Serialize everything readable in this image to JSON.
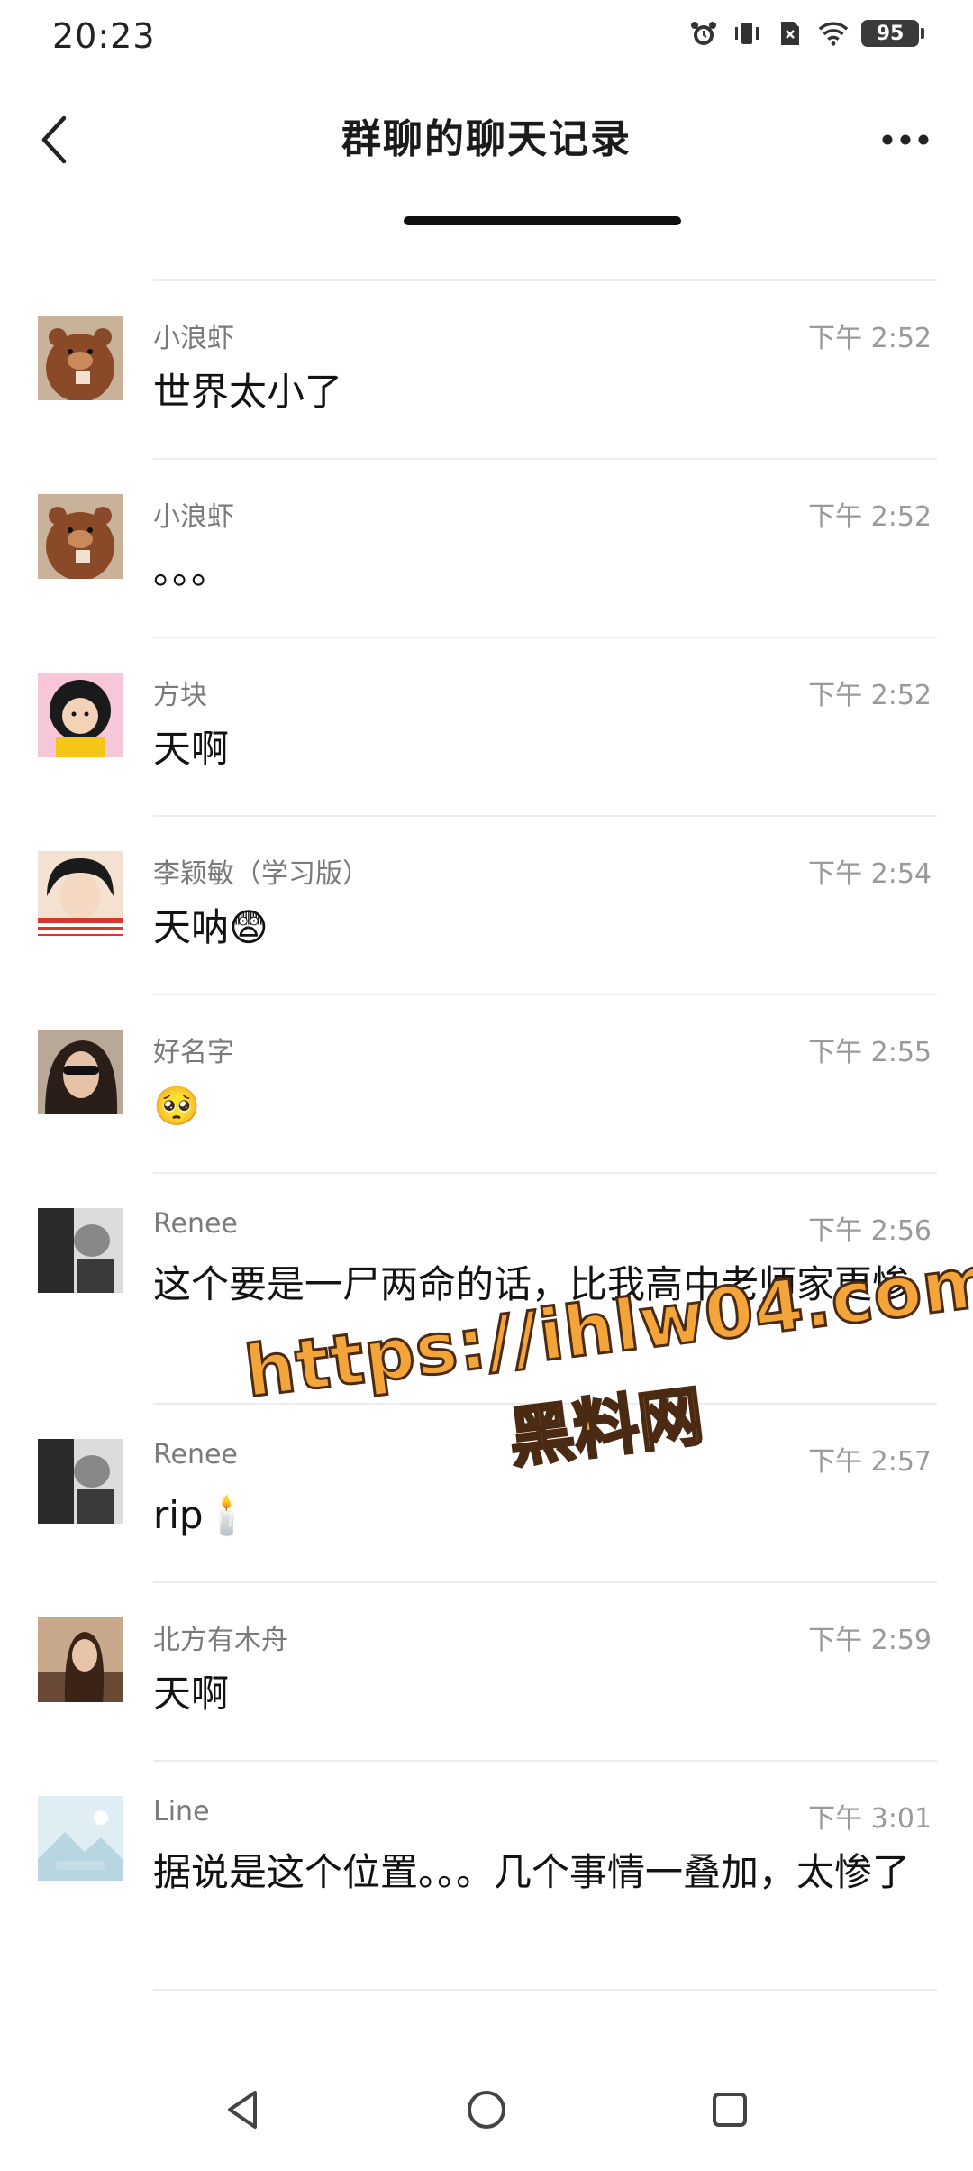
{
  "status": {
    "time": "20:23",
    "battery": "95"
  },
  "header": {
    "title": "群聊的聊天记录"
  },
  "messages": [
    {
      "sender": "小浪虾",
      "time": "下午 2:52",
      "text": "世界太小了",
      "avatar": "bear-avatar",
      "avatar_color": "#8a4a2a"
    },
    {
      "sender": "小浪虾",
      "time": "下午 2:52",
      "text": "。。。",
      "avatar": "bear-avatar",
      "avatar_color": "#8a4a2a"
    },
    {
      "sender": "方块",
      "time": "下午 2:52",
      "text": "天啊",
      "avatar": "cartoon-girl-avatar",
      "avatar_color": "#e85a8a"
    },
    {
      "sender": "李颖敏（学习版）",
      "time": "下午 2:54",
      "text": "天呐😨",
      "avatar": "illustrated-girl-avatar",
      "avatar_color": "#d9362f"
    },
    {
      "sender": "好名字",
      "time": "下午 2:55",
      "text": "🥺",
      "avatar": "sunglasses-woman-avatar",
      "avatar_color": "#3a2a22"
    },
    {
      "sender": "Renee",
      "time": "下午 2:56",
      "text": "这个要是一尸两命的话，比我高中老师家更惨",
      "avatar": "bw-photo-avatar",
      "avatar_color": "#666666"
    },
    {
      "sender": "Renee",
      "time": "下午 2:57",
      "text": "rip🕯️",
      "avatar": "bw-photo-avatar",
      "avatar_color": "#666666"
    },
    {
      "sender": "北方有木舟",
      "time": "下午 2:59",
      "text": "天啊",
      "avatar": "woman-outdoor-avatar",
      "avatar_color": "#7a5a4a"
    },
    {
      "sender": "Line",
      "time": "下午 3:01",
      "text": "据说是这个位置。。。几个事情一叠加，太惨了",
      "avatar": "placeholder-image-avatar",
      "avatar_color": "#cfe3ea"
    }
  ],
  "watermark": {
    "url": "https://ihlw04.com",
    "name": "黑料网"
  }
}
